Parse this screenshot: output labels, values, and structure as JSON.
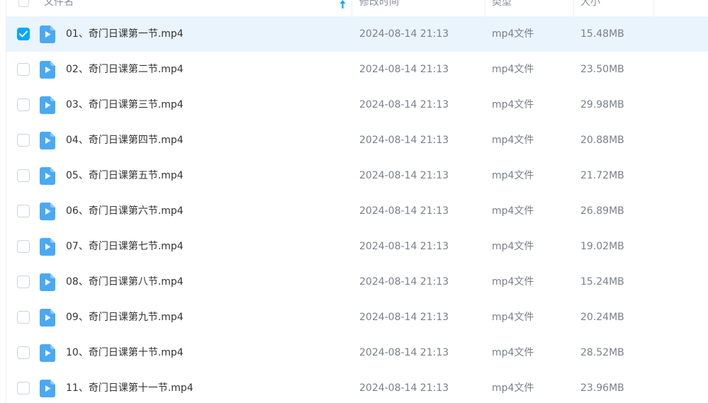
{
  "header": {
    "name_label": "文件名",
    "modified_label": "修改时间",
    "type_label": "类型",
    "size_label": "大小"
  },
  "files": [
    {
      "name": "01、奇门日课第一节.mp4",
      "modified": "2024-08-14 21:13",
      "type": "mp4文件",
      "size": "15.48MB",
      "selected": true
    },
    {
      "name": "02、奇门日课第二节.mp4",
      "modified": "2024-08-14 21:13",
      "type": "mp4文件",
      "size": "23.50MB",
      "selected": false
    },
    {
      "name": "03、奇门日课第三节.mp4",
      "modified": "2024-08-14 21:13",
      "type": "mp4文件",
      "size": "29.98MB",
      "selected": false
    },
    {
      "name": "04、奇门日课第四节.mp4",
      "modified": "2024-08-14 21:13",
      "type": "mp4文件",
      "size": "20.88MB",
      "selected": false
    },
    {
      "name": "05、奇门日课第五节.mp4",
      "modified": "2024-08-14 21:13",
      "type": "mp4文件",
      "size": "21.72MB",
      "selected": false
    },
    {
      "name": "06、奇门日课第六节.mp4",
      "modified": "2024-08-14 21:13",
      "type": "mp4文件",
      "size": "26.89MB",
      "selected": false
    },
    {
      "name": "07、奇门日课第七节.mp4",
      "modified": "2024-08-14 21:13",
      "type": "mp4文件",
      "size": "19.02MB",
      "selected": false
    },
    {
      "name": "08、奇门日课第八节.mp4",
      "modified": "2024-08-14 21:13",
      "type": "mp4文件",
      "size": "15.24MB",
      "selected": false
    },
    {
      "name": "09、奇门日课第九节.mp4",
      "modified": "2024-08-14 21:13",
      "type": "mp4文件",
      "size": "20.24MB",
      "selected": false
    },
    {
      "name": "10、奇门日课第十节.mp4",
      "modified": "2024-08-14 21:13",
      "type": "mp4文件",
      "size": "28.52MB",
      "selected": false
    },
    {
      "name": "11、奇门日课第十一节.mp4",
      "modified": "2024-08-14 21:13",
      "type": "mp4文件",
      "size": "23.96MB",
      "selected": false
    }
  ],
  "colors": {
    "accent": "#06a7ff",
    "selected_row": "#eaf4fd",
    "video_icon": "#4aa9f5"
  },
  "icons": {
    "file_icon": "video-file-icon",
    "sort_icon": "sort-up-arrow-icon",
    "check_icon": "checkmark-icon"
  }
}
